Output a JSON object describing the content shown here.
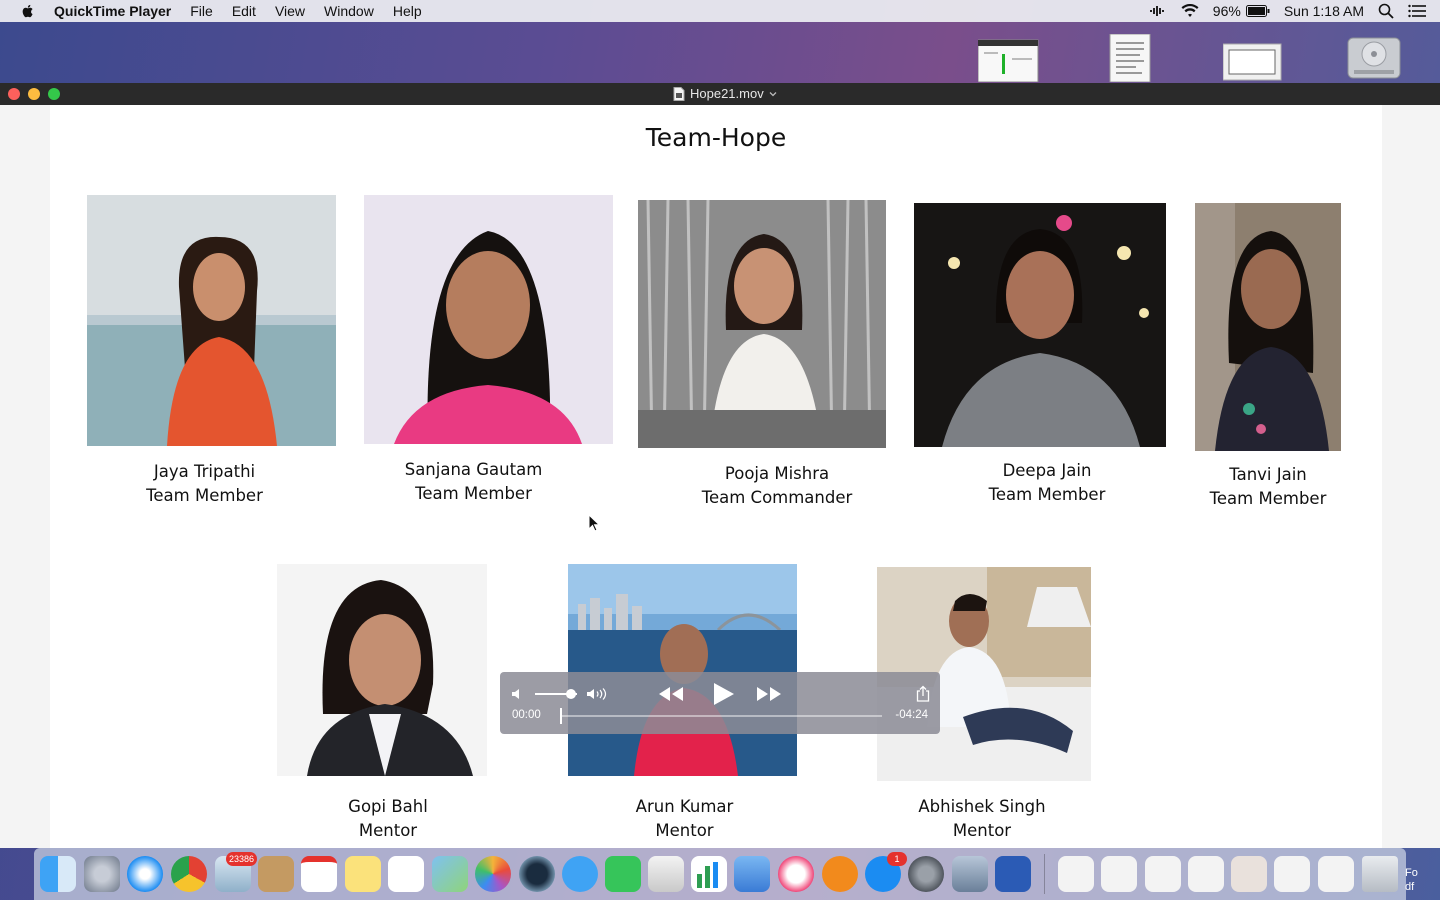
{
  "menubar": {
    "app_name": "QuickTime Player",
    "items": [
      "File",
      "Edit",
      "View",
      "Window",
      "Help"
    ],
    "battery": "96%",
    "clock": "Sun 1:18 AM"
  },
  "window": {
    "title": "Hope21.mov"
  },
  "slide": {
    "title": "Team-Hope",
    "members": [
      {
        "name": "Jaya Tripathi",
        "role": "Team Member"
      },
      {
        "name": "Sanjana Gautam",
        "role": "Team Member"
      },
      {
        "name": "Pooja Mishra",
        "role": "Team Commander"
      },
      {
        "name": "Deepa Jain",
        "role": "Team Member"
      },
      {
        "name": "Tanvi Jain",
        "role": "Team Member"
      },
      {
        "name": "Gopi Bahl",
        "role": "Mentor"
      },
      {
        "name": "Arun Kumar",
        "role": "Mentor"
      },
      {
        "name": "Abhishek Singh",
        "role": "Mentor"
      }
    ]
  },
  "player": {
    "elapsed": "00:00",
    "remaining": "-04:24",
    "progress": 0.0,
    "volume": 0.85
  },
  "dock": {
    "mail_badge": "23386",
    "appstore_badge": "1",
    "partial_label_1": "Fo",
    "partial_label_2": "df"
  },
  "colors": {
    "accent": "#1b8cf2",
    "close": "#fc605c",
    "minimize": "#fdbc40",
    "zoom": "#34c84a"
  }
}
